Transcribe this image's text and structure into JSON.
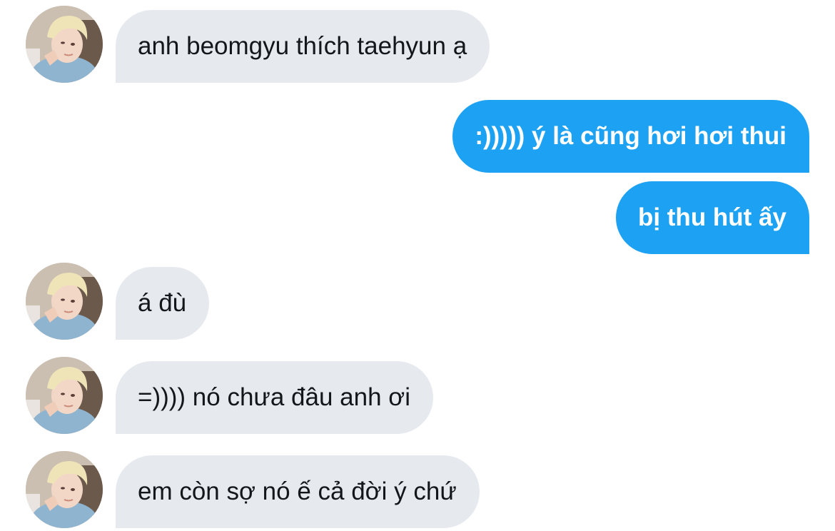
{
  "colors": {
    "incoming_bubble": "#e6eaef",
    "outgoing_bubble": "#1da1f2",
    "incoming_text": "#14171a",
    "outgoing_text": "#ffffff"
  },
  "messages": [
    {
      "direction": "incoming",
      "text": "anh beomgyu thích taehyun ạ",
      "avatar": "profile-photo"
    },
    {
      "direction": "outgoing",
      "text": ":))))) ý là cũng hơi hơi thui"
    },
    {
      "direction": "outgoing",
      "text": "bị thu hút ấy"
    },
    {
      "direction": "incoming",
      "text": "á đù",
      "avatar": "profile-photo"
    },
    {
      "direction": "incoming",
      "text": "=)))) nó chưa đâu anh ơi",
      "avatar": "profile-photo"
    },
    {
      "direction": "incoming",
      "text": "em còn sợ nó ế cả đời ý chứ",
      "avatar": "profile-photo"
    }
  ]
}
